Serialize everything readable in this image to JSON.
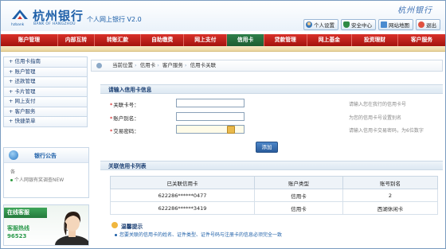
{
  "header": {
    "bank_name_cn": "杭州银行",
    "bank_name_en": "BANK OF HANGZHOU",
    "logo_tag": "hzbank",
    "system_title": "个人网上银行 V2.0",
    "calligraphy": "杭州银行",
    "links": [
      {
        "label": "个人设置",
        "icon": "user-icon"
      },
      {
        "label": "安全中心",
        "icon": "shield-icon"
      },
      {
        "label": "网站地图",
        "icon": "map-icon"
      },
      {
        "label": "退出",
        "icon": "exit-icon"
      }
    ]
  },
  "nav": {
    "items": [
      {
        "label": "账户管理",
        "active": false
      },
      {
        "label": "内部互转",
        "active": false
      },
      {
        "label": "转账汇款",
        "active": false
      },
      {
        "label": "自助缴费",
        "active": false
      },
      {
        "label": "网上支付",
        "active": false
      },
      {
        "label": "信用卡",
        "active": true
      },
      {
        "label": "贷款管理",
        "active": false
      },
      {
        "label": "网上基金",
        "active": false
      },
      {
        "label": "投资理财",
        "active": false
      },
      {
        "label": "客户服务",
        "active": false
      }
    ]
  },
  "sidebar": {
    "items": [
      {
        "label": "+ 信用卡指南"
      },
      {
        "label": "+ 账户管理"
      },
      {
        "label": "+ 还款管理"
      },
      {
        "label": "+ 卡片管理"
      },
      {
        "label": "+ 网上支付"
      },
      {
        "label": "+ 客户服务"
      },
      {
        "label": "+ 快捷菜单"
      }
    ]
  },
  "notice": {
    "title": "银行公告",
    "line1": "各",
    "line2": "个人网银有奖调查NEW"
  },
  "service": {
    "tab": "在线客服",
    "hotline_label": "客服热线",
    "hotline_number": "96523"
  },
  "breadcrumb": {
    "items": [
      "当前位置",
      "信用卡",
      "客户服务",
      "信用卡关联"
    ]
  },
  "form": {
    "section_title": "请输入信用卡信息",
    "fields": [
      {
        "label": "关联卡号：",
        "hint": "请输入您在我行的信用卡号"
      },
      {
        "label": "账户别名：",
        "hint": "为您的信用卡号设置别名"
      },
      {
        "label": "交易密码：",
        "hint": "请输入信用卡交易密码，为6位数字"
      }
    ],
    "add_button": "添加"
  },
  "table": {
    "section_title": "关联信用卡列表",
    "headers": [
      "已关联信用卡",
      "账户类型",
      "账号别名"
    ],
    "rows": [
      [
        "622286******0477",
        "信用卡",
        "2"
      ],
      [
        "622286******3419",
        "信用卡",
        "西湖休闲卡"
      ]
    ]
  },
  "tips": {
    "title": "温馨提示",
    "text": "您要关联的信用卡的姓名、证件类型、证件号码与注册卡的信息必须完全一致"
  }
}
